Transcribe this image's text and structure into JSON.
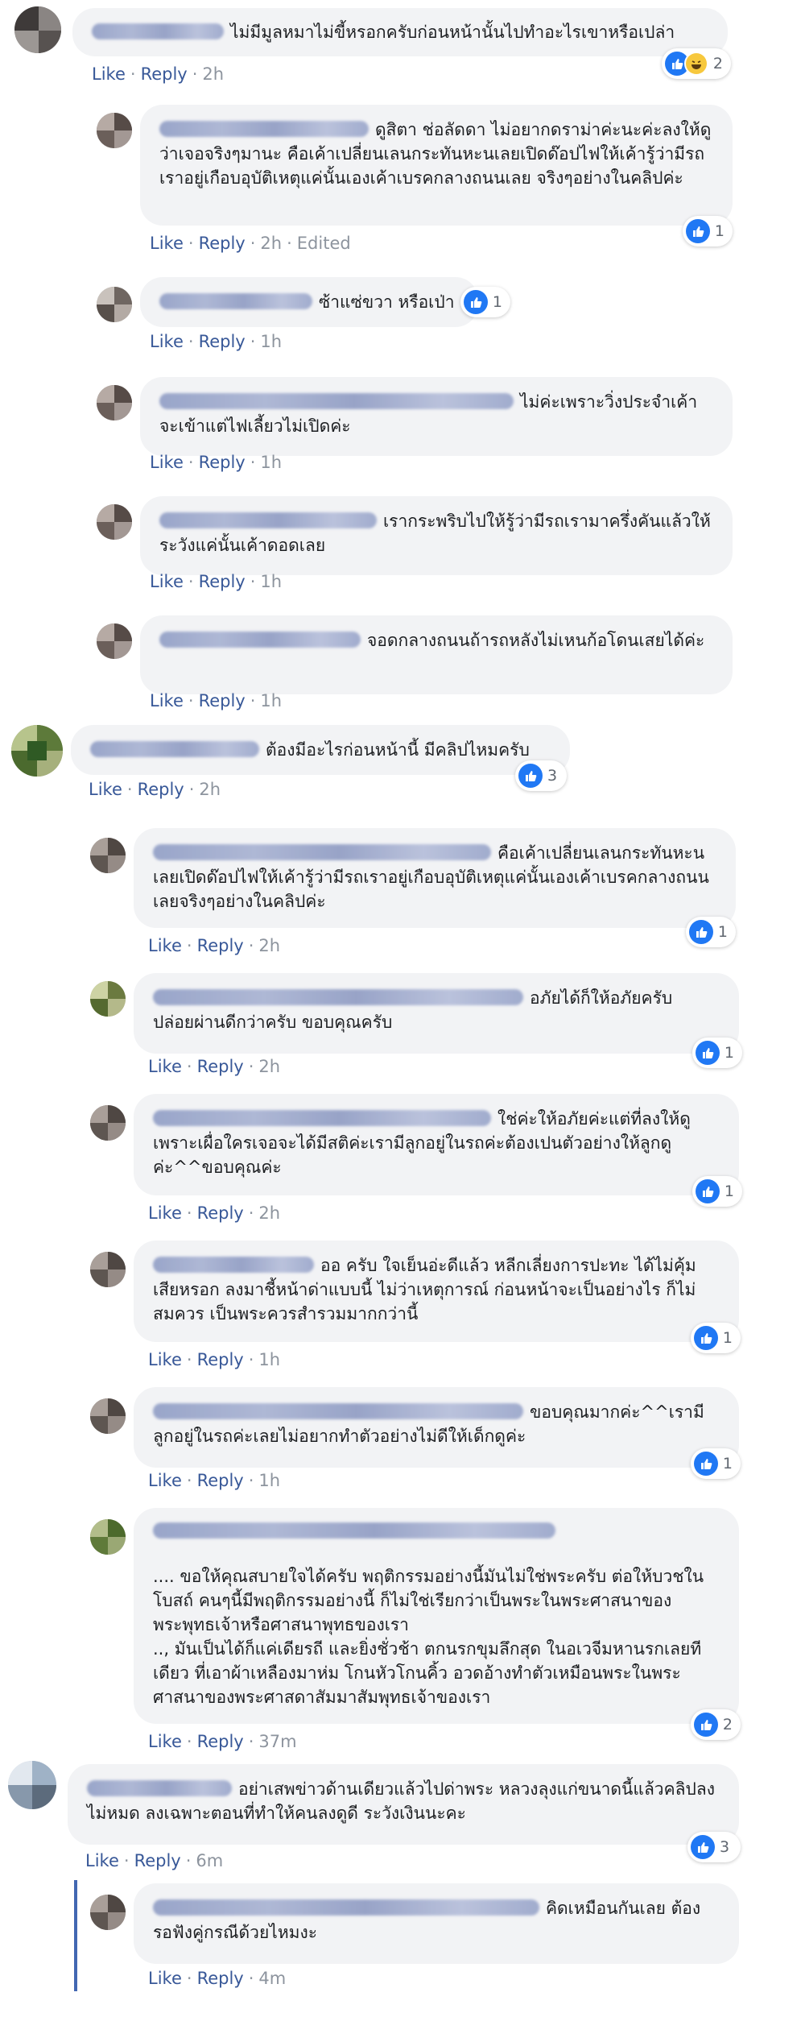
{
  "actions": {
    "like": "Like",
    "reply": "Reply",
    "edited": "Edited"
  },
  "colors": {
    "bubble": "#f2f3f5",
    "link": "#385898",
    "meta": "#8d949e",
    "like_blue": "#2078f4"
  },
  "comments": [
    {
      "id": "c1",
      "level": 0,
      "text": "ไม่มีมูลหมาไม่ขี้หรอกครับก่อนหน้านั้นไปทำอะไรเขาหรือเปล่า",
      "time": "2h",
      "reaction_icons": [
        "like-icon",
        "haha-icon"
      ],
      "reaction_count": "2"
    },
    {
      "id": "c2",
      "level": 1,
      "text": "ดูสิตา ช่อลัดดา ไม่อยากดราม่าค่ะนะค่ะลงให้ดูว่าเจอจริงๆมานะ คือเค้าเปลี่ยนเลนกระทันหะนเลยเปิดด๊อปไฟให้เค้ารู้ว่ามีรถเราอยู่เกือบอุบัติเหตุแค่นั้นเองเค้าเบรคกลางถนนเลย จริงๆอย่างในคลิปค่ะ",
      "time": "2h",
      "edited": true,
      "reaction_icons": [
        "like-icon"
      ],
      "reaction_count": "1"
    },
    {
      "id": "c3",
      "level": 1,
      "text": "ซ้าแซ่ขวา หรือเป่า",
      "time": "1h",
      "reaction_icons": [
        "like-icon"
      ],
      "reaction_count": "1"
    },
    {
      "id": "c4",
      "level": 1,
      "text": "ไม่ค่ะเพราะวิ่งประจำเค้าจะเข้าแต่ไฟเลี้ยวไม่เปิดค่ะ",
      "time": "1h"
    },
    {
      "id": "c5",
      "level": 1,
      "text": "เรากระพริบไปให้รู้ว่ามีรถเรามาครึ่งคันแล้วให้ระวังแค่นั้นเค้าดอดเลย",
      "time": "1h"
    },
    {
      "id": "c6",
      "level": 1,
      "text": "จอดกลางถนนถ้ารถหลังไม่เหนก้อโดนเสยได้ค่ะ",
      "time": "1h"
    },
    {
      "id": "c7",
      "level": 0,
      "text": "ต้องมีอะไรก่อนหน้านี้ มีคลิปไหมครับ",
      "time": "2h",
      "reaction_icons": [
        "like-icon"
      ],
      "reaction_count": "3"
    },
    {
      "id": "c8",
      "level": 1,
      "text": "คือเค้าเปลี่ยนเลนกระทันหะนเลยเปิดด๊อปไฟให้เค้ารู้ว่ามีรถเราอยู่เกือบอุบัติเหตุแค่นั้นเองเค้าเบรคกลางถนนเลยจริงๆอย่างในคลิปค่ะ",
      "time": "2h",
      "reaction_icons": [
        "like-icon"
      ],
      "reaction_count": "1"
    },
    {
      "id": "c9",
      "level": 1,
      "text": "อภัยได้ก็ให้อภัยครับ ปล่อยผ่านดีกว่าครับ ขอบคุณครับ",
      "time": "2h",
      "reaction_icons": [
        "like-icon"
      ],
      "reaction_count": "1"
    },
    {
      "id": "c10",
      "level": 1,
      "text": "ใช่ค่ะให้อภัยค่ะแต่ที่ลงให้ดู เพราะเผื่อใครเจอจะได้มีสติค่ะเรามีลูกอยู่ในรถค่ะต้องเปนตัวอย่างให้ลูกดูค่ะ^^ขอบคุณค่ะ",
      "time": "2h",
      "reaction_icons": [
        "like-icon"
      ],
      "reaction_count": "1"
    },
    {
      "id": "c11",
      "level": 1,
      "text": "ออ ครับ ใจเย็นอ่ะดีแล้ว หลีกเลี่ยงการปะทะ ได้ไม่คุ้มเสียหรอก ลงมาชี้หน้าด่าแบบนี้ ไม่ว่าเหตุการณ์ ก่อนหน้าจะเป็นอย่างไร ก็ไม่สมควร เป็นพระควรสำรวมมากกว่านี้",
      "time": "1h",
      "reaction_icons": [
        "like-icon"
      ],
      "reaction_count": "1"
    },
    {
      "id": "c12",
      "level": 1,
      "text": "ขอบคุณมากค่ะ^^เรามีลูกอยู่ในรถค่ะเลยไม่อยากทำตัวอย่างไม่ดีให้เด็กดูค่ะ",
      "time": "1h",
      "reaction_icons": [
        "like-icon"
      ],
      "reaction_count": "1"
    },
    {
      "id": "c13",
      "level": 1,
      "text": ".... ขอให้คุณสบายใจได้ครับ พฤติกรรมอย่างนี้มันไม่ใช่พระครับ ต่อให้บวชในโบสถ์ คนๆนี้มีพฤติกรรมอย่างนี้ ก็ไม่ใช่เรียกว่าเป็นพระในพระศาสนาของพระพุทธเจ้าหรือศาสนาพุทธของเรา",
      "text2": ".., มันเป็นได้ก็แค่เดียรถี และยิ่งชั่วช้า ตกนรกขุมลึกสุด ในอเวจีมหานรกเลยทีเดียว ที่เอาผ้าเหลืองมาห่ม โกนหัวโกนคิ้ว อวดอ้างทำตัวเหมือนพระในพระศาสนาของพระศาสดาสัมมาสัมพุทธเจ้าของเรา",
      "time": "37m",
      "reaction_icons": [
        "like-icon"
      ],
      "reaction_count": "2"
    },
    {
      "id": "c14",
      "level": 0,
      "text": "อย่าเสพข่าวด้านเดียวแล้วไปด่าพระ หลวงลุงแก่ขนาดนี้แล้วคลิปลงไม่หมด ลงเฉพาะตอนที่ทำให้คนลงดูดี ระวังเงินนะคะ",
      "time": "6m",
      "reaction_icons": [
        "like-icon"
      ],
      "reaction_count": "3"
    },
    {
      "id": "c15",
      "level": 1,
      "text": "คิดเหมือนกันเลย ต้องรอฟังคู่กรณีด้วยไหมงะ",
      "time": "4m"
    }
  ]
}
